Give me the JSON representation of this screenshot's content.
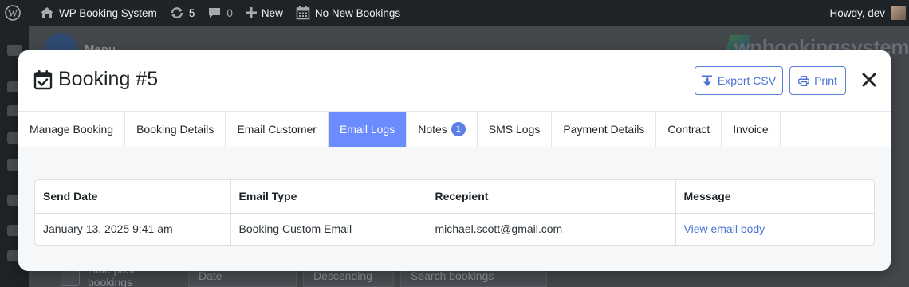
{
  "adminbar": {
    "site_name": "WP Booking System",
    "updates_count": "5",
    "comments_count": "0",
    "new_label": "New",
    "bookings_label": "No New Bookings",
    "howdy": "Howdy, dev"
  },
  "background": {
    "menu_label": "Menu",
    "logo_text": "wpbookingsystem",
    "hide_past_label": "Hide past bookings",
    "sort_field": "Date",
    "sort_order": "Descending",
    "search_placeholder": "Search bookings"
  },
  "modal": {
    "title": "Booking #5",
    "export_label": "Export CSV",
    "print_label": "Print",
    "tabs": [
      {
        "label": "Manage Booking"
      },
      {
        "label": "Booking Details"
      },
      {
        "label": "Email Customer"
      },
      {
        "label": "Email Logs",
        "active": true
      },
      {
        "label": "Notes",
        "badge": "1"
      },
      {
        "label": "SMS Logs"
      },
      {
        "label": "Payment Details"
      },
      {
        "label": "Contract"
      },
      {
        "label": "Invoice"
      }
    ],
    "table": {
      "headers": [
        "Send Date",
        "Email Type",
        "Recepient",
        "Message"
      ],
      "rows": [
        [
          "January 13, 2025 9:41 am",
          "Booking Custom Email",
          "michael.scott@gmail.com",
          "View email body"
        ]
      ]
    }
  },
  "colors": {
    "accent": "#6b8cff",
    "button_border": "#5b7fd8",
    "adminbar_bg": "#1d2327"
  }
}
